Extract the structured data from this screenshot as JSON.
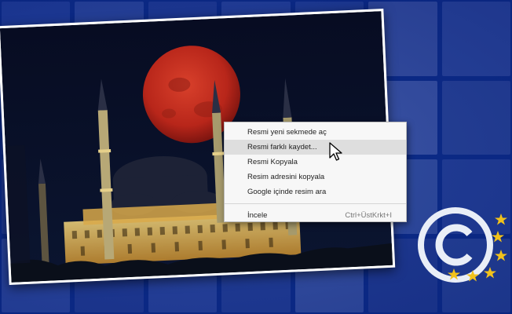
{
  "context_menu": {
    "items": [
      {
        "label": "Resmi yeni sekmede aç"
      },
      {
        "label": "Resmi farklı kaydet..."
      },
      {
        "label": "Resmi Kopyala"
      },
      {
        "label": "Resim adresini kopyala"
      },
      {
        "label": "Google içinde resim ara"
      }
    ],
    "inspect": {
      "label": "İncele",
      "shortcut": "Ctrl+ÜstKrkt+I"
    }
  },
  "colors": {
    "moon": "#b8261a",
    "mosque_lights": "#f0c85a",
    "night_sky": "#060b1e",
    "background_blue": "#0d2f8a",
    "copyright_ring": "#e9eef7",
    "stars": "#f2c21b"
  },
  "icons": {
    "cursor": "arrow-cursor-icon",
    "logo": "copyright-icon",
    "stars": "eu-star-icon"
  }
}
